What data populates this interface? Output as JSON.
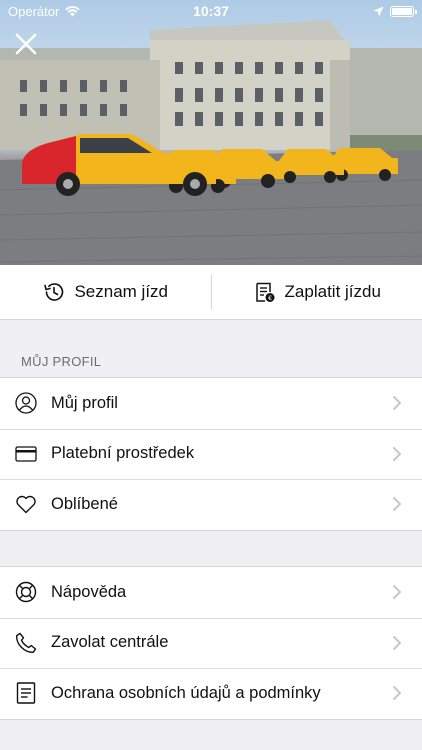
{
  "status_bar": {
    "carrier": "Operátor",
    "time": "10:37"
  },
  "actions": {
    "history_label": "Seznam jízd",
    "pay_label": "Zaplatit jízdu"
  },
  "profile_section": {
    "title": "MŮJ PROFIL",
    "items": [
      {
        "label": "Můj profil",
        "icon": "user-icon"
      },
      {
        "label": "Platební prostředek",
        "icon": "credit-card-icon"
      },
      {
        "label": "Oblíbené",
        "icon": "heart-icon"
      }
    ]
  },
  "support_section": {
    "items": [
      {
        "label": "Nápověda",
        "icon": "lifebuoy-icon"
      },
      {
        "label": "Zavolat centrále",
        "icon": "phone-icon"
      },
      {
        "label": "Ochrana osobních údajů a podmínky",
        "icon": "document-icon"
      }
    ]
  },
  "colors": {
    "taxi_yellow": "#f2b51c",
    "taxi_red_stripe": "#d8262c",
    "list_background": "#efeff4"
  }
}
